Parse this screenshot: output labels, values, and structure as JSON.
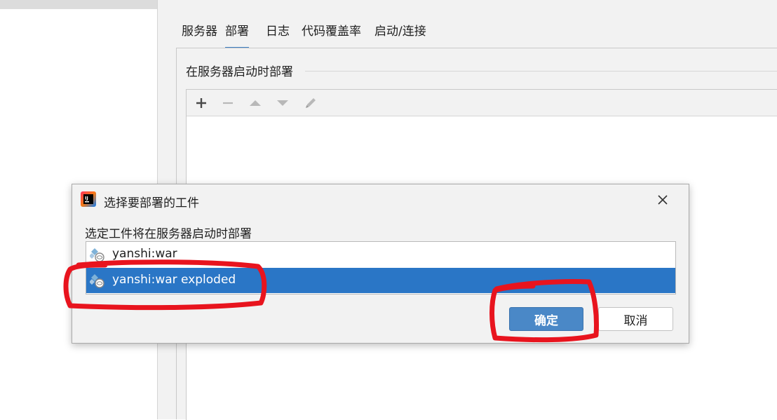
{
  "tabs": [
    {
      "label": "服务器",
      "active": false
    },
    {
      "label": "部署",
      "active": true
    },
    {
      "label": "日志",
      "active": false
    },
    {
      "label": "代码覆盖率",
      "active": false
    },
    {
      "label": "启动/连接",
      "active": false
    }
  ],
  "deployment": {
    "section_title": "在服务器启动时部署",
    "toolbar": {
      "add_icon": "plus-icon",
      "remove_icon": "minus-icon",
      "move_up_icon": "arrow-up-icon",
      "move_down_icon": "arrow-down-icon",
      "edit_icon": "pencil-icon"
    }
  },
  "dialog": {
    "title": "选择要部署的工件",
    "app_icon": "intellij-idea-icon",
    "label": "选定工件将在服务器启动时部署",
    "artifacts": [
      {
        "name": "yanshi:war",
        "selected": false,
        "icon": "artifact-icon"
      },
      {
        "name": "yanshi:war exploded",
        "selected": true,
        "icon": "artifact-icon"
      }
    ],
    "ok_label": "确定",
    "cancel_label": "取消"
  },
  "colors": {
    "accent": "#2a76c6",
    "ok_button": "#4a88c7",
    "tab_underline": "#3d7ec3",
    "annotation_red": "#e8141e"
  }
}
